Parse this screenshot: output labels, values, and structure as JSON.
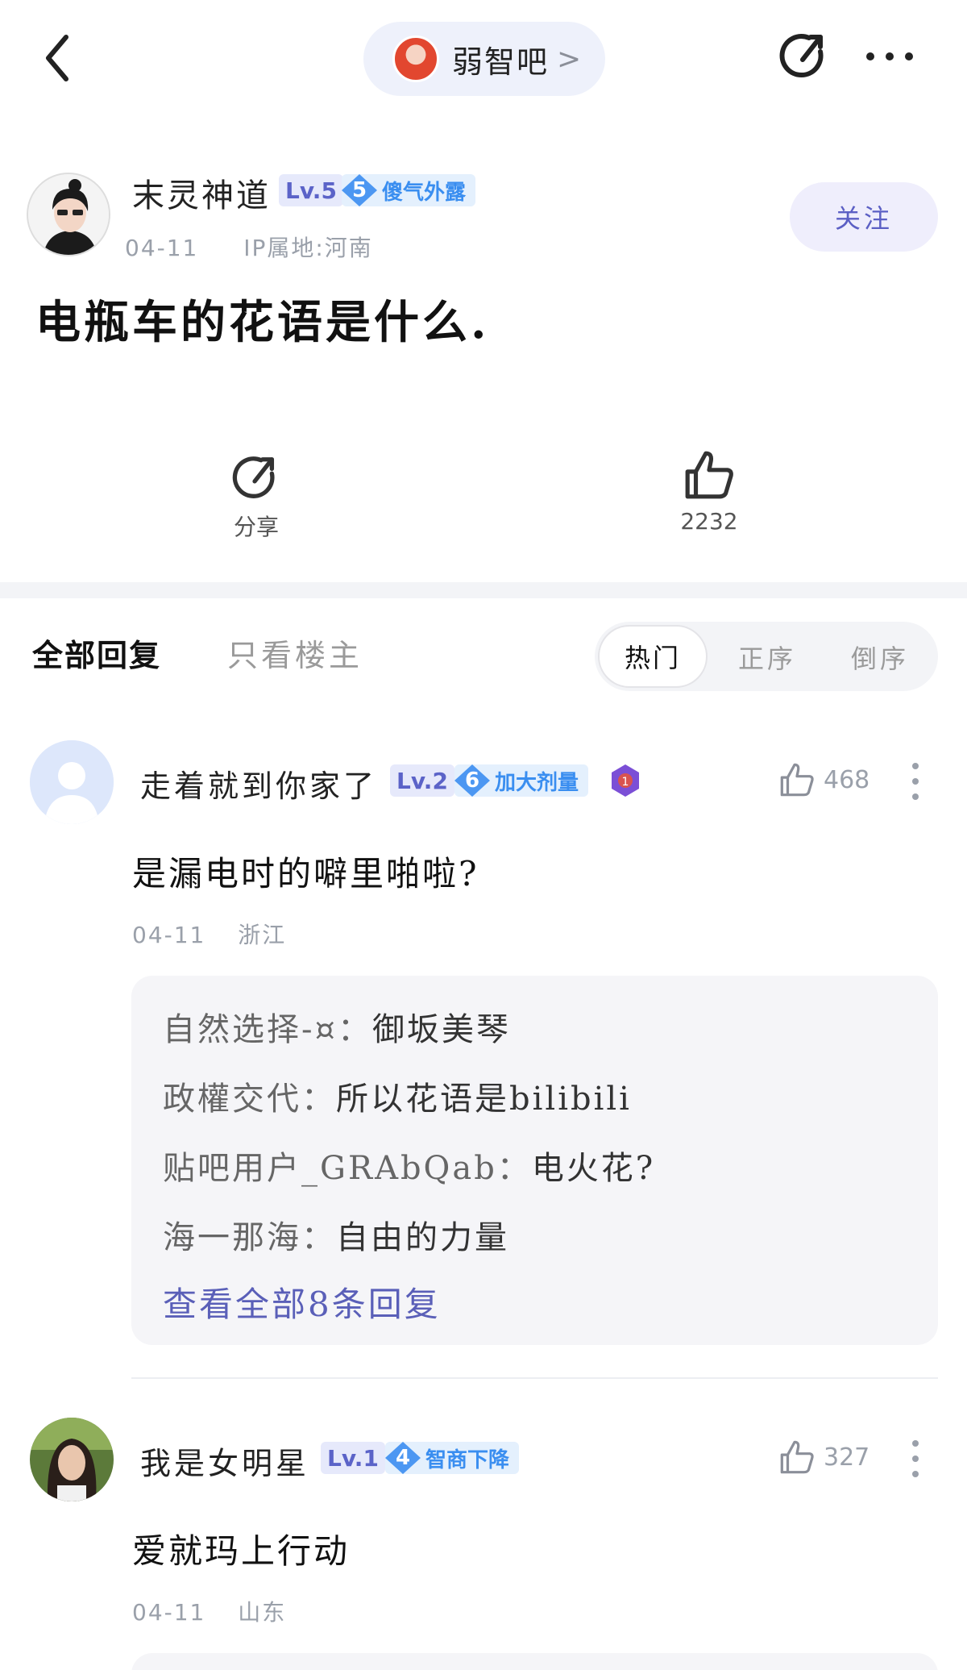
{
  "forum": {
    "name": "弱智吧",
    "chevron": ">"
  },
  "op": {
    "name": "末灵神道",
    "level": "Lv.5",
    "title_num": "5",
    "title": "傻气外露",
    "date": "04-11",
    "ip": "IP属地:河南",
    "follow_label": "关注"
  },
  "post": {
    "title": "电瓶车的花语是什么."
  },
  "actions": {
    "share_label": "分享",
    "like_count": "2232"
  },
  "tabs": {
    "all_replies": "全部回复",
    "op_only": "只看楼主"
  },
  "sort": {
    "hot": "热门",
    "asc": "正序",
    "desc": "倒序"
  },
  "comments": [
    {
      "name": "走着就到你家了",
      "level": "Lv.2",
      "title_num": "6",
      "title": "加大剂量",
      "likes": "468",
      "text": "是漏电时的噼里啪啦?",
      "date": "04-11",
      "location": "浙江",
      "replies": [
        {
          "user": "自然选择-¤：",
          "text": "御坂美琴"
        },
        {
          "user": "政權交代：",
          "text": "所以花语是bilibili"
        },
        {
          "user": "贴吧用户_GRAbQab：",
          "text": "电火花?"
        },
        {
          "user": "海一那海：",
          "text": "自由的力量"
        }
      ],
      "view_all": "查看全部8条回复"
    },
    {
      "name": "我是女明星",
      "level": "Lv.1",
      "title_num": "4",
      "title": "智商下降",
      "likes": "327",
      "text": "爱就玛上行动",
      "date": "04-11",
      "location": "山东"
    }
  ],
  "colors": {
    "accent": "#5b5fc4",
    "link": "#5a5fb8",
    "title_badge": "#3a8ef0"
  }
}
